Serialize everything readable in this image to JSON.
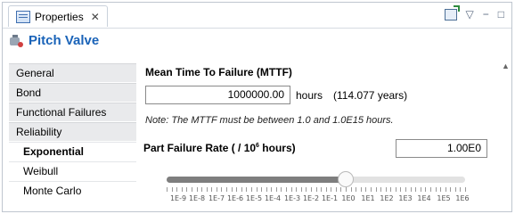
{
  "tab": {
    "label": "Properties",
    "close": "✕"
  },
  "view_tools": {
    "menu": "▽",
    "minimize": "−",
    "maximize": "□"
  },
  "header": {
    "title": "Pitch Valve"
  },
  "sidebar": {
    "items": [
      {
        "label": "General"
      },
      {
        "label": "Bond"
      },
      {
        "label": "Functional Failures"
      },
      {
        "label": "Reliability"
      },
      {
        "label": "Exponential"
      },
      {
        "label": "Weibull"
      },
      {
        "label": "Monte Carlo"
      }
    ]
  },
  "mttf": {
    "title": "Mean Time To Failure (MTTF)",
    "value": "1000000.00",
    "unit": "hours",
    "years": "(114.077 years)",
    "note": "Note: The MTTF must be between 1.0 and 1.0E15 hours."
  },
  "pfr": {
    "title_prefix": "Part Failure Rate ( / 10",
    "title_exp": "6",
    "title_suffix": " hours)",
    "value": "1.00E0"
  },
  "slider": {
    "position_fraction": 0.6,
    "tick_labels": [
      "1E-9",
      "1E-8",
      "1E-7",
      "1E-6",
      "1E-5",
      "1E-4",
      "1E-3",
      "1E-2",
      "1E-1",
      "1E0",
      "1E1",
      "1E2",
      "1E3",
      "1E4",
      "1E5",
      "1E6"
    ]
  },
  "scrollbar": {
    "up_arrow": "▲"
  }
}
